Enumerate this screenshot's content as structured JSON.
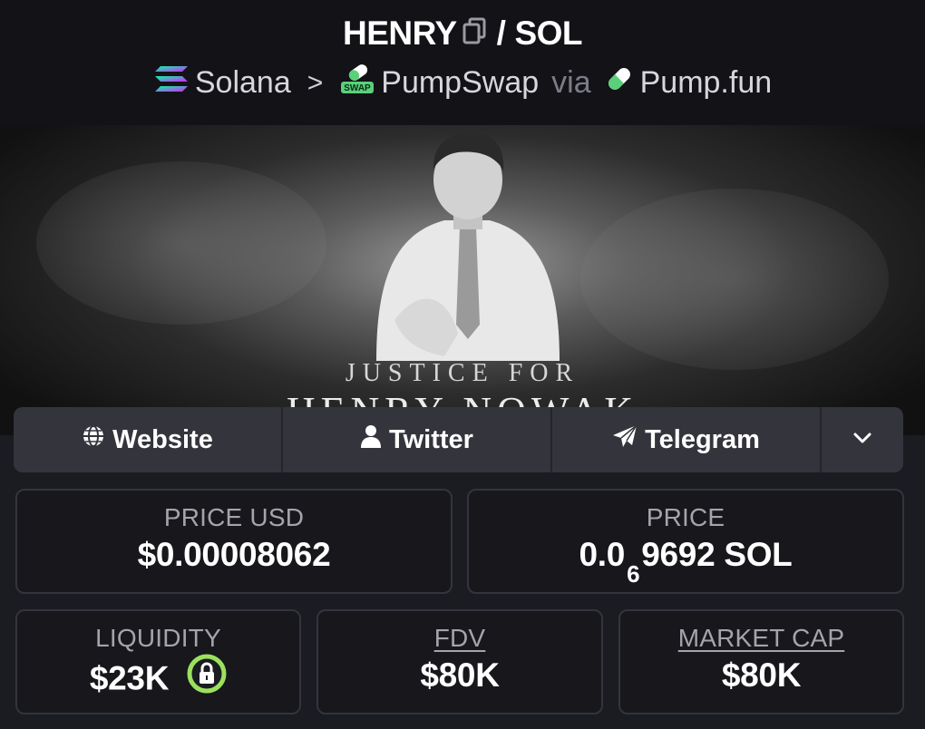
{
  "header": {
    "base_token": "HENRY",
    "slash": "/",
    "quote_token": "SOL",
    "chain": "Solana",
    "separator": ">",
    "dex": "PumpSwap",
    "via_label": "via",
    "launchpad": "Pump.fun",
    "dex_badge": "SWAP"
  },
  "banner": {
    "caption_top": "JUSTICE FOR",
    "caption_bottom": "HENRY NOWAK"
  },
  "links": {
    "website_label": "Website",
    "twitter_label": "Twitter",
    "telegram_label": "Telegram"
  },
  "stats": {
    "price_usd_label": "PRICE USD",
    "price_usd_value": "$0.00008062",
    "price_label": "PRICE",
    "price_prefix": "0.0",
    "price_zero_count": "6",
    "price_suffix": "9692 SOL",
    "liquidity_label": "LIQUIDITY",
    "liquidity_value": "$23K",
    "fdv_label": "FDV",
    "fdv_value": "$80K",
    "mcap_label": "MARKET CAP",
    "mcap_value": "$80K"
  },
  "colors": {
    "background": "#1b1b22",
    "header_bg": "#121217",
    "card_border": "#34343d",
    "lock_green": "#9be15d"
  }
}
